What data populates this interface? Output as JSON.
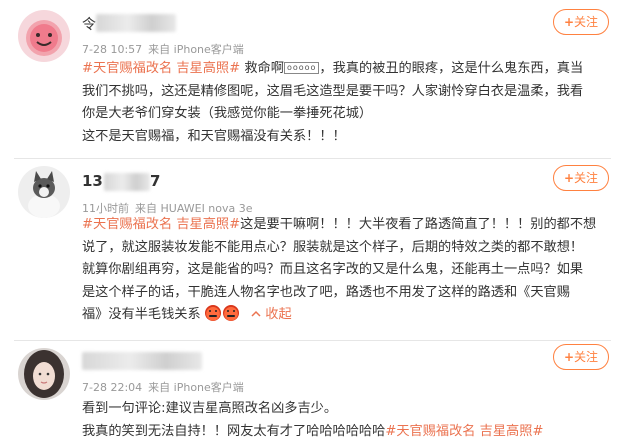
{
  "posts": [
    {
      "username": "令",
      "time": "7-28 10:57",
      "source": "来自 iPhone客户端",
      "follow_label": "关注",
      "follow_plus": "+",
      "lines": [
        {
          "tag": "#天官赐福改名 吉星高照#",
          "before_mark": " 救命啊",
          "mark": "ooooo",
          "after_mark": "，我真的被丑的眼疼，这是什么鬼东西，真当"
        },
        {
          "text": "我们不挑吗，这还是精修图呢，这眉毛这造型是要干吗？人家谢怜穿白衣是温柔，我看"
        },
        {
          "text": "你是大老爷们穿女装（我感觉你能一拳捶死花城）"
        },
        {
          "text": "这不是天官赐福，和天官赐福没有关系！！！"
        }
      ]
    },
    {
      "username": "13",
      "username_tail": "7",
      "time": "11小时前",
      "source": "来自 HUAWEI nova 3e",
      "follow_label": "关注",
      "follow_plus": "+",
      "lines": [
        {
          "tag": "#天官赐福改名 吉星高照#",
          "text": "这是要干嘛啊！！！大半夜看了路透简直了！！！别的都不想"
        },
        {
          "text": "说了，就这服装妆发能不能用点心？服装就是这个样子，后期的特效之类的都不敢想！"
        },
        {
          "text": "就算你剧组再穷，这是能省的吗？而且这名字改的又是什么鬼，还能再土一点吗？如果"
        },
        {
          "text": "是这个样子的话，干脆连人物名字也改了吧，路透也不用发了这样的路透和《天官赐"
        },
        {
          "text": "福》没有半毛钱关系",
          "collapse": "收起"
        }
      ]
    },
    {
      "time": "7-28 22:04",
      "source": "来自 iPhone客户端",
      "follow_label": "关注",
      "follow_plus": "+",
      "lines": [
        {
          "text": "看到一句评论:建议吉星高照改名凶多吉少。"
        },
        {
          "text": "我真的笑到无法自持！！网友太有才了哈哈哈哈哈哈",
          "tag": "#天官赐福改名 吉星高照#"
        }
      ]
    }
  ],
  "colors": {
    "accent": "#eb7350",
    "follow": "#ff8140",
    "meta": "#999999",
    "text": "#333333"
  }
}
